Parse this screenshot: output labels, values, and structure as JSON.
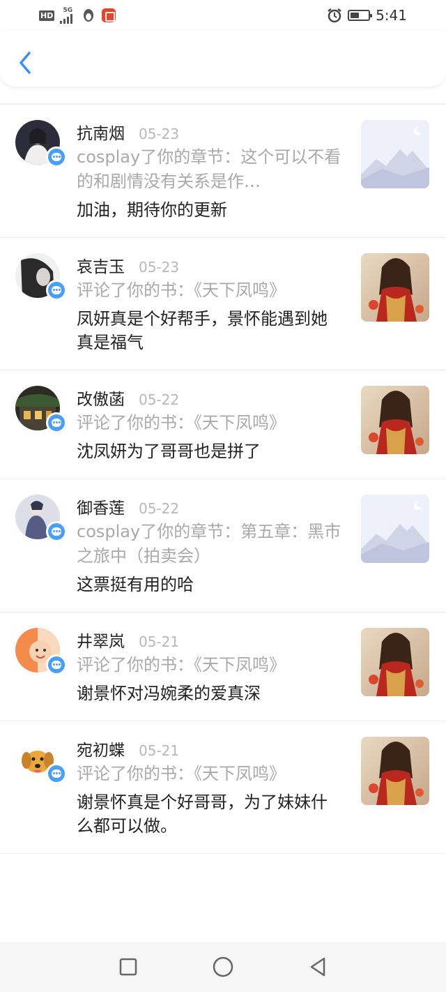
{
  "status_bar": {
    "hd": "HD",
    "network": "5G",
    "time": "5:41",
    "battery_level": 0.5
  },
  "header": {
    "back_icon": "chevron-left-icon"
  },
  "colors": {
    "accent": "#4a9ef5",
    "back_arrow": "#3a8ff0"
  },
  "notifications": [
    {
      "name": "抗南烟",
      "date": "05-23",
      "action": "cosplay了你的章节：这个可以不看的和剧情没有关系是作…",
      "comment": "加油，期待你的更新",
      "thumb": "mountain"
    },
    {
      "name": "哀吉玉",
      "date": "05-23",
      "action": "评论了你的书：《天下凤鸣》",
      "comment": "凤妍真是个好帮手，景怀能遇到她真是福气",
      "thumb": "book-cover"
    },
    {
      "name": "改傲菡",
      "date": "05-22",
      "action": "评论了你的书：《天下凤鸣》",
      "comment": "沈凤妍为了哥哥也是拼了",
      "thumb": "book-cover"
    },
    {
      "name": "御香莲",
      "date": "05-22",
      "action": "cosplay了你的章节：第五章：黑市之旅中（拍卖会）",
      "comment": "这票挺有用的哈",
      "thumb": "mountain"
    },
    {
      "name": "井翠岚",
      "date": "05-21",
      "action": "评论了你的书：《天下凤鸣》",
      "comment": "谢景怀对冯婉柔的爱真深",
      "thumb": "book-cover"
    },
    {
      "name": "宛初蝶",
      "date": "05-21",
      "action": "评论了你的书：《天下凤鸣》",
      "comment": "谢景怀真是个好哥哥，为了妹妹什么都可以做。",
      "thumb": "book-cover"
    }
  ],
  "nav": {
    "recent_icon": "square-icon",
    "home_icon": "circle-icon",
    "back_icon": "triangle-back-icon"
  }
}
